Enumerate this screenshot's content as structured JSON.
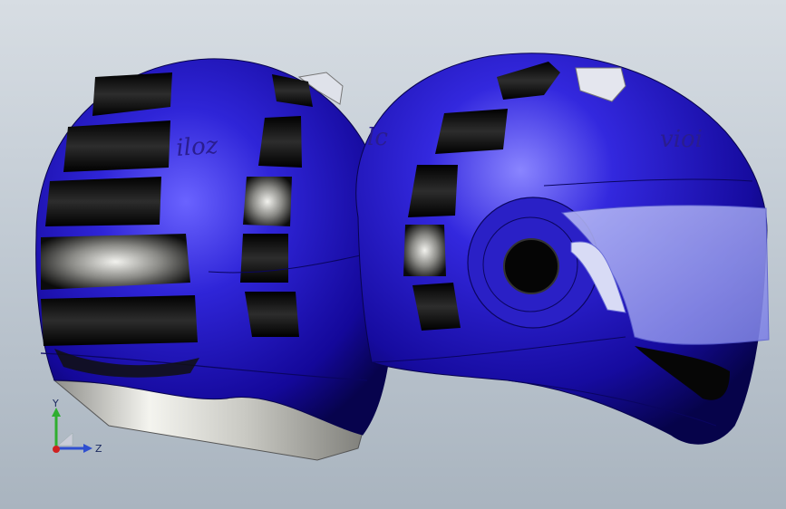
{
  "viewport": {
    "background_top": "#d7dde3",
    "background_bottom": "#a9b4bf"
  },
  "model": {
    "shell_color": "#2b22c9",
    "shell_dark": "#0f0870",
    "vent_color": "#0a0a0a",
    "visor_color": "#9fa3f0",
    "liner_color": "#e9e9e3",
    "left_logo_text": "iloz",
    "center_logo_text": "lc",
    "right_logo_text": "vioi"
  },
  "triad": {
    "y_label": "Y",
    "z_label": "Z",
    "x_icon": "x-axis-dot-icon",
    "y_color": "#2fae2f",
    "z_color": "#2f4fd0",
    "x_color": "#d02020"
  }
}
